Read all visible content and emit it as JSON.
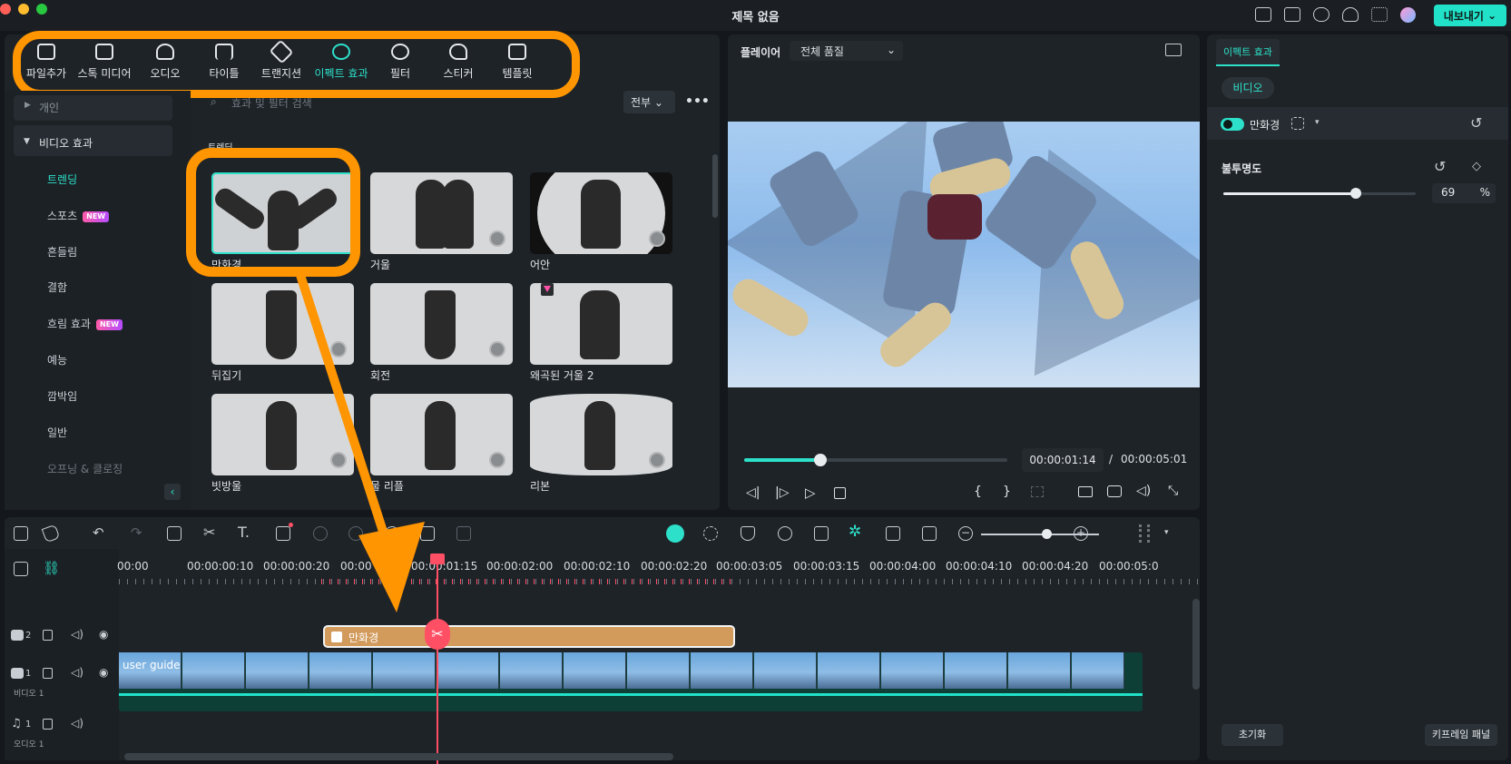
{
  "app": {
    "title": "제목 없음",
    "export_label": "내보내기",
    "accent": "#21e1c8",
    "highlight_color": "#ff9500",
    "playhead_color": "#ff4f64"
  },
  "toolbar": {
    "items": [
      {
        "label": "파일추가",
        "icon": "image-icon"
      },
      {
        "label": "스톡 미디어",
        "icon": "stock-media-icon"
      },
      {
        "label": "오디오",
        "icon": "music-note-icon"
      },
      {
        "label": "타이틀",
        "icon": "text-t-icon"
      },
      {
        "label": "트랜지션",
        "icon": "transition-icon"
      },
      {
        "label": "이펙트 효과",
        "icon": "effects-sparkle-icon",
        "active": true
      },
      {
        "label": "필터",
        "icon": "filter-circles-icon"
      },
      {
        "label": "스티커",
        "icon": "sticker-icon"
      },
      {
        "label": "템플릿",
        "icon": "template-grid-icon"
      }
    ]
  },
  "sidebar": {
    "personal": "개인",
    "group": "비디오 효과",
    "items": [
      {
        "label": "트렌딩",
        "active": true
      },
      {
        "label": "스포츠",
        "badge": "NEW"
      },
      {
        "label": "흔들림"
      },
      {
        "label": "결함"
      },
      {
        "label": "흐림 효과",
        "badge": "NEW"
      },
      {
        "label": "예능"
      },
      {
        "label": "깜박임"
      },
      {
        "label": "일반"
      },
      {
        "label": "오프닝 & 클로징"
      }
    ]
  },
  "browser": {
    "search_placeholder": "효과 및 필터 검색",
    "filter_label": "전부",
    "section": "트렌딩",
    "effects": [
      {
        "label": "만화경"
      },
      {
        "label": "거울"
      },
      {
        "label": "어안"
      },
      {
        "label": "뒤집기"
      },
      {
        "label": "회전"
      },
      {
        "label": "왜곡된 거울 2"
      },
      {
        "label": "빗방울"
      },
      {
        "label": "물 리플"
      },
      {
        "label": "리본"
      }
    ]
  },
  "player": {
    "label": "플레이어",
    "quality": "전체 품질",
    "current_time": "00:00:01:14",
    "separator": "/",
    "total_time": "00:00:05:01",
    "progress_fraction": 0.29
  },
  "properties": {
    "tab": "이펙트 효과",
    "subtab": "비디오",
    "effect_name": "만화경",
    "effect_enabled": true,
    "opacity_label": "불투명도",
    "opacity_value": "69",
    "opacity_unit": "%",
    "opacity_fraction": 0.69,
    "reset_label": "초기화",
    "keyframe_label": "키프레임 패널"
  },
  "timeline": {
    "ruler": [
      "00:00",
      "00:00:00:10",
      "00:00:00:20",
      "00:00",
      "00:00:01:15",
      "00:00:02:00",
      "00:00:02:10",
      "00:00:02:20",
      "00:00:03:05",
      "00:00:03:15",
      "00:00:04:00",
      "00:00:04:10",
      "00:00:04:20",
      "00:00:05:0"
    ],
    "tracks": {
      "track2_num": "2",
      "track1_num": "1",
      "track1_name": "비디오 1",
      "audio_num": "1",
      "audio_name": "오디오 1"
    },
    "effect_clip": "만화경",
    "video_clip": "user guide"
  }
}
